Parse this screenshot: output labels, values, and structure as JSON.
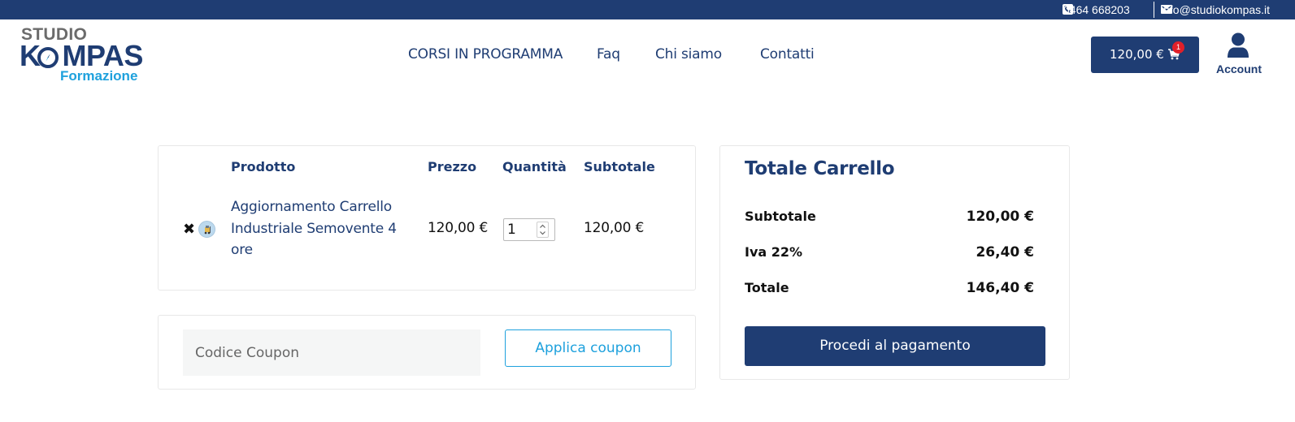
{
  "topbar": {
    "phone": "0464 668203",
    "email": "info@studiokompas.it",
    "icons": [
      "phone-icon",
      "envelope-icon"
    ]
  },
  "logo": {
    "line1": "STUDIO",
    "line2_prefix": "K",
    "line2_suffix": "MPAS",
    "line3": "Formazione"
  },
  "nav": {
    "items": [
      {
        "label": "CORSI IN PROGRAMMA"
      },
      {
        "label": "Faq"
      },
      {
        "label": "Chi siamo"
      },
      {
        "label": "Contatti"
      }
    ]
  },
  "header": {
    "cart_amount": "120,00 €",
    "cart_count": "1",
    "account_label": "Account"
  },
  "cart": {
    "columns": {
      "product": "Prodotto",
      "price": "Prezzo",
      "quantity": "Quantità",
      "subtotal": "Subtotale"
    },
    "items": [
      {
        "remove_symbol": "✖",
        "name": "Aggiornamento Carrello Industriale Semovente 4 ore",
        "price": "120,00 €",
        "quantity": "1",
        "subtotal": "120,00 €"
      }
    ]
  },
  "coupon": {
    "placeholder": "Codice Coupon",
    "button_label": "Applica coupon"
  },
  "totals": {
    "title": "Totale Carrello",
    "rows": [
      {
        "label": "Subtotale",
        "value": "120,00 €"
      },
      {
        "label": "Iva 22%",
        "value": "26,40 €"
      },
      {
        "label": "Totale",
        "value": "146,40 €"
      }
    ],
    "checkout_label": "Procedi al pagamento"
  },
  "colors": {
    "brand_navy": "#1f3d73",
    "accent_blue": "#1ea1dd",
    "badge_red": "#e0202a"
  }
}
